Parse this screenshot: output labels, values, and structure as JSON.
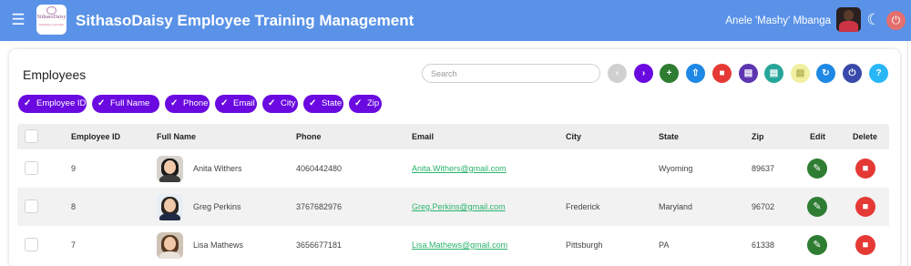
{
  "app": {
    "title": "SithasoDaisy Employee Training Management",
    "logo_name": "SithasoDaisy",
    "logo_tagline": "building is possible",
    "user_name": "Anele 'Mashy' Mbanga",
    "menu_icon": "hamburger-menu-icon",
    "theme_icon": "moon-icon",
    "logout_icon": "power-icon"
  },
  "card": {
    "title": "Employees",
    "search_placeholder": "Search"
  },
  "toolbar": [
    {
      "name": "prev-page-button",
      "icon": "chevron-left-icon",
      "glyph": "‹",
      "color": "#d0d0d0"
    },
    {
      "name": "next-page-button",
      "icon": "chevron-right-icon",
      "glyph": "›",
      "color": "#6a0ae0"
    },
    {
      "name": "add-button",
      "icon": "plus-icon",
      "glyph": "+",
      "color": "#2e7d32"
    },
    {
      "name": "upload-button",
      "icon": "upload-icon",
      "glyph": "⇧",
      "color": "#1e88e5"
    },
    {
      "name": "delete-all-button",
      "icon": "trash-icon",
      "glyph": "■",
      "color": "#e53935"
    },
    {
      "name": "pdf-button",
      "icon": "file-pdf-icon",
      "glyph": "▤",
      "color": "#5e35b1"
    },
    {
      "name": "excel-button",
      "icon": "file-excel-icon",
      "glyph": "▤",
      "color": "#26a69a"
    },
    {
      "name": "csv-button",
      "icon": "file-icon",
      "glyph": "▤",
      "color": "#f0f0a0"
    },
    {
      "name": "refresh-button",
      "icon": "refresh-icon",
      "glyph": "↻",
      "color": "#1e88e5"
    },
    {
      "name": "power-button",
      "icon": "power-icon",
      "glyph": "⏻",
      "color": "#3949ab"
    },
    {
      "name": "help-button",
      "icon": "question-icon",
      "glyph": "?",
      "color": "#29b6f6"
    }
  ],
  "chips": [
    "Employee ID",
    "Full Name",
    "Phone",
    "Email",
    "City",
    "State",
    "Zip"
  ],
  "columns": {
    "id": "Employee ID",
    "name": "Full Name",
    "phone": "Phone",
    "email": "Email",
    "city": "City",
    "state": "State",
    "zip": "Zip",
    "edit": "Edit",
    "delete": "Delete"
  },
  "rows": [
    {
      "id": "9",
      "name": "Anita Withers",
      "phone": "4060442480",
      "email": "Anita.Withers@gmail.com",
      "city": "",
      "state": "Wyoming",
      "zip": "89637"
    },
    {
      "id": "8",
      "name": "Greg Perkins",
      "phone": "3767682976",
      "email": "Greg.Perkins@gmail.com",
      "city": "Frederick",
      "state": "Maryland",
      "zip": "96702"
    },
    {
      "id": "7",
      "name": "Lisa Mathews",
      "phone": "3656677181",
      "email": "Lisa.Mathews@gmail.com",
      "city": "Pittsburgh",
      "state": "PA",
      "zip": "61338"
    }
  ],
  "colors": {
    "appbar": "#5a92e8",
    "chip": "#6a0ae0",
    "link": "#2ab36b",
    "edit": "#2e7d32",
    "delete": "#e53935"
  }
}
